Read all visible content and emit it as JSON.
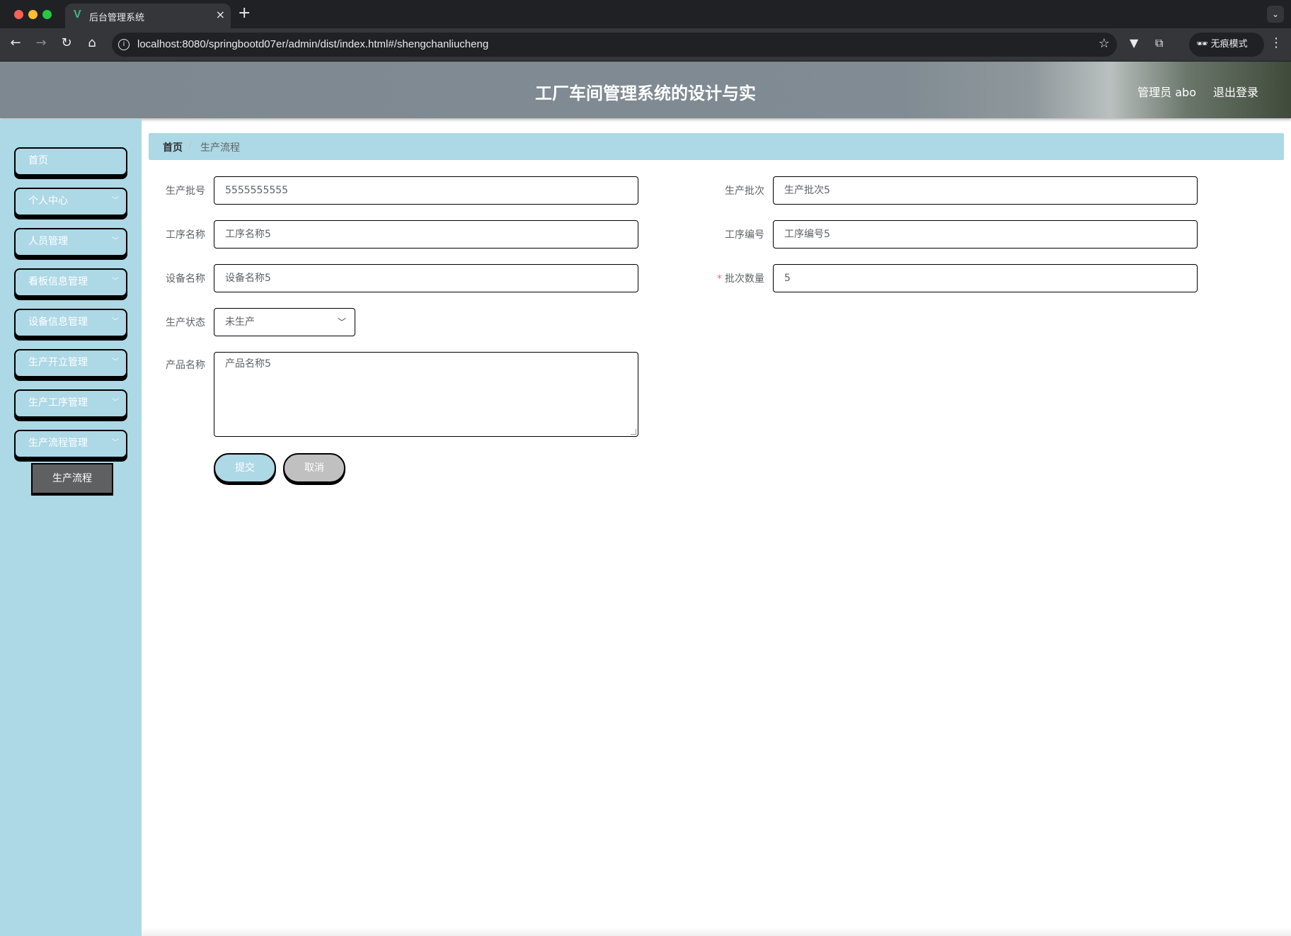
{
  "browser": {
    "tab_title": "后台管理系统",
    "tab_favicon": "V",
    "tab_close": "×",
    "new_tab": "+",
    "url": "localhost:8080/springbootd07er/admin/dist/index.html#/shengchanliucheng",
    "incognito_label": "无痕模式"
  },
  "header": {
    "title": "工厂车间管理系统的设计与实",
    "user": "管理员 abo",
    "logout": "退出登录"
  },
  "sidebar": {
    "items": [
      {
        "label": "首页",
        "has_chevron": false
      },
      {
        "label": "个人中心",
        "has_chevron": true
      },
      {
        "label": "人员管理",
        "has_chevron": true
      },
      {
        "label": "看板信息管理",
        "has_chevron": true
      },
      {
        "label": "设备信息管理",
        "has_chevron": true
      },
      {
        "label": "生产开立管理",
        "has_chevron": true
      },
      {
        "label": "生产工序管理",
        "has_chevron": true
      },
      {
        "label": "生产流程管理",
        "has_chevron": true
      }
    ],
    "active_subitem": "生产流程"
  },
  "breadcrumb": {
    "home": "首页",
    "separator": "/",
    "current": "生产流程"
  },
  "form": {
    "batch_no": {
      "label": "生产批号",
      "value": "5555555555"
    },
    "batch": {
      "label": "生产批次",
      "value": "生产批次5"
    },
    "process_name": {
      "label": "工序名称",
      "value": "工序名称5"
    },
    "process_no": {
      "label": "工序编号",
      "value": "工序编号5"
    },
    "device_name": {
      "label": "设备名称",
      "value": "设备名称5"
    },
    "batch_qty": {
      "label": "批次数量",
      "value": "5",
      "required_mark": "*"
    },
    "status": {
      "label": "生产状态",
      "value": "未生产"
    },
    "product_name": {
      "label": "产品名称",
      "value": "产品名称5"
    },
    "submit": "提交",
    "cancel": "取消"
  },
  "colors": {
    "sidebar_bg": "#add8e6",
    "active_submenu_bg": "#5f6062",
    "cancel_bg": "#c0c0c0"
  }
}
